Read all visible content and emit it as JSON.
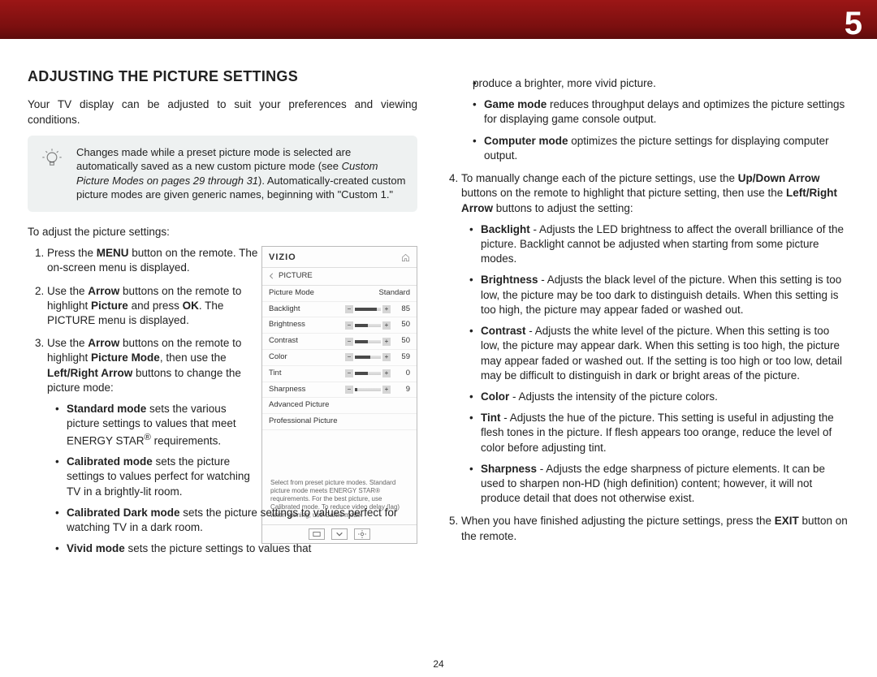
{
  "chapter_number": "5",
  "page_number": "24",
  "section_title": "ADJUSTING THE PICTURE SETTINGS",
  "intro": "Your TV display can be adjusted to suit your preferences and viewing conditions.",
  "tipbox": {
    "prefix": "Changes made while a preset picture mode is selected are automatically saved as a new custom picture mode (see ",
    "link": "Custom Picture Modes on pages 29 through 31",
    "suffix": "). Automatically-created custom picture modes are given generic names, beginning with \"Custom 1.\""
  },
  "lead_in": "To adjust the picture settings:",
  "steps": {
    "s1": {
      "a": "Press the ",
      "b": "MENU",
      "c": " button on the remote. The on-screen menu is displayed."
    },
    "s2": {
      "a": "Use the ",
      "b": "Arrow",
      "c": " buttons on the remote to highlight ",
      "d": "Picture",
      "e": " and press ",
      "f": "OK",
      "g": ". The PICTURE menu is displayed."
    },
    "s3": {
      "a": "Use the ",
      "b": "Arrow",
      "c": " buttons on the remote to highlight ",
      "d": "Picture Mode",
      "e": ", then use the ",
      "f": "Left/Right Arrow",
      "g": " buttons to change the picture mode:"
    },
    "s3_modes": {
      "standard": {
        "b": "Standard mode",
        "t1": " sets the various picture settings to values that meet ENERGY STAR",
        "t2": " requirements."
      },
      "calibrated": {
        "b": "Calibrated mode",
        "t": " sets the picture settings to values perfect for watching TV in a brightly-lit room."
      },
      "calibrated_dark": {
        "b": "Calibrated Dark mode",
        "t": " sets the picture settings to values perfect for watching TV in a dark room."
      },
      "vivid": {
        "b": "Vivid mode",
        "t": " sets the picture settings to values that"
      }
    },
    "s3_modes_cont": {
      "vivid_cont": "produce a brighter, more vivid picture.",
      "game": {
        "b": "Game mode",
        "t": " reduces throughput delays and optimizes the picture settings for displaying game console output."
      },
      "computer": {
        "b": "Computer mode",
        "t": " optimizes the picture settings for displaying computer output."
      }
    },
    "s4": {
      "a": "To manually change each of the picture settings, use the ",
      "b": "Up/Down Arrow",
      "c": " buttons on the remote to highlight that picture setting, then use the ",
      "d": "Left/Right Arrow",
      "e": " buttons to adjust the setting:"
    },
    "s4_settings": {
      "backlight": {
        "b": "Backlight",
        "t": " - Adjusts the LED brightness to affect the overall brilliance of the picture. Backlight cannot be adjusted when starting from some picture modes."
      },
      "brightness": {
        "b": "Brightness",
        "t": " - Adjusts the black level of the picture. When this setting is too low, the picture may be too dark to distinguish details. When this setting is too high, the picture may appear faded or washed out."
      },
      "contrast": {
        "b": "Contrast",
        "t": " - Adjusts the white level of the picture. When this setting is too low, the picture may appear dark. When this setting is too high, the picture may appear faded or washed out. If the setting is too high or too low, detail may be difficult to distinguish in dark or bright areas of the picture."
      },
      "color": {
        "b": "Color",
        "t": " - Adjusts the intensity of the picture colors."
      },
      "tint": {
        "b": "Tint",
        "t": " - Adjusts the hue of the picture. This setting is useful in adjusting the flesh tones in the picture. If flesh appears too orange, reduce the level of color before adjusting tint."
      },
      "sharpness": {
        "b": "Sharpness",
        "t": " - Adjusts the edge sharpness of picture elements. It can be used to sharpen non-HD (high definition) content; however, it will not produce detail that does not otherwise exist."
      }
    },
    "s5": {
      "a": "When you have finished adjusting the picture settings, press the ",
      "b": "EXIT",
      "c": " button on the remote."
    }
  },
  "osd": {
    "logo": "VIZIO",
    "crumb": "PICTURE",
    "rows": [
      {
        "label": "Picture Mode",
        "value": "Standard"
      },
      {
        "label": "Backlight",
        "value": "85",
        "fill": 85
      },
      {
        "label": "Brightness",
        "value": "50",
        "fill": 50
      },
      {
        "label": "Contrast",
        "value": "50",
        "fill": 50
      },
      {
        "label": "Color",
        "value": "59",
        "fill": 59
      },
      {
        "label": "Tint",
        "value": "0",
        "fill": 50
      },
      {
        "label": "Sharpness",
        "value": "9",
        "fill": 9
      }
    ],
    "links": [
      "Advanced Picture",
      "Professional Picture"
    ],
    "note": "Select from preset picture modes. Standard picture mode meets ENERGY STAR® requirements. For the best picture, use Calibrated mode. To reduce video delay (lag) when gaming, use Game mode."
  }
}
